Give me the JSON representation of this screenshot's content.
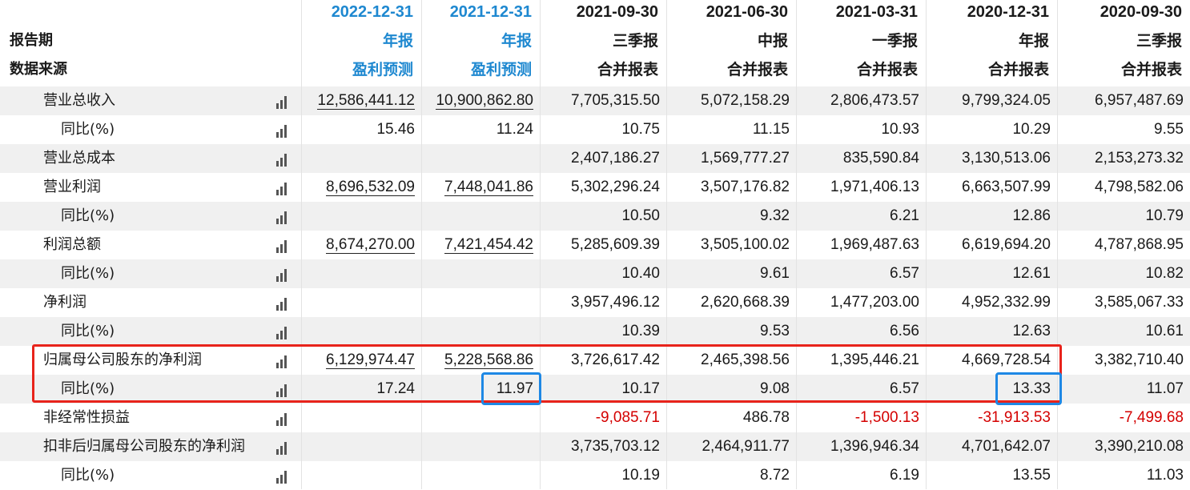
{
  "header": {
    "row_labels": [
      "报告期",
      "数据来源"
    ],
    "columns": [
      {
        "date": "2022-12-31",
        "period": "年报",
        "source": "盈利预测",
        "forecast": true
      },
      {
        "date": "2021-12-31",
        "period": "年报",
        "source": "盈利预测",
        "forecast": true
      },
      {
        "date": "2021-09-30",
        "period": "三季报",
        "source": "合并报表",
        "forecast": false
      },
      {
        "date": "2021-06-30",
        "period": "中报",
        "source": "合并报表",
        "forecast": false
      },
      {
        "date": "2021-03-31",
        "period": "一季报",
        "source": "合并报表",
        "forecast": false
      },
      {
        "date": "2020-12-31",
        "period": "年报",
        "source": "合并报表",
        "forecast": false
      },
      {
        "date": "2020-09-30",
        "period": "三季报",
        "source": "合并报表",
        "forecast": false
      }
    ]
  },
  "rows": [
    {
      "label": "营业总收入",
      "indent": false,
      "values": [
        "12,586,441.12",
        "10,900,862.80",
        "7,705,315.50",
        "5,072,158.29",
        "2,806,473.57",
        "9,799,324.05",
        "6,957,487.69"
      ]
    },
    {
      "label": "同比(%)",
      "indent": true,
      "values": [
        "15.46",
        "11.24",
        "10.75",
        "11.15",
        "10.93",
        "10.29",
        "9.55"
      ]
    },
    {
      "label": "营业总成本",
      "indent": false,
      "values": [
        "",
        "",
        "2,407,186.27",
        "1,569,777.27",
        "835,590.84",
        "3,130,513.06",
        "2,153,273.32"
      ]
    },
    {
      "label": "营业利润",
      "indent": false,
      "values": [
        "8,696,532.09",
        "7,448,041.86",
        "5,302,296.24",
        "3,507,176.82",
        "1,971,406.13",
        "6,663,507.99",
        "4,798,582.06"
      ]
    },
    {
      "label": "同比(%)",
      "indent": true,
      "values": [
        "",
        "",
        "10.50",
        "9.32",
        "6.21",
        "12.86",
        "10.79"
      ]
    },
    {
      "label": "利润总额",
      "indent": false,
      "values": [
        "8,674,270.00",
        "7,421,454.42",
        "5,285,609.39",
        "3,505,100.02",
        "1,969,487.63",
        "6,619,694.20",
        "4,787,868.95"
      ]
    },
    {
      "label": "同比(%)",
      "indent": true,
      "values": [
        "",
        "",
        "10.40",
        "9.61",
        "6.57",
        "12.61",
        "10.82"
      ]
    },
    {
      "label": "净利润",
      "indent": false,
      "values": [
        "",
        "",
        "3,957,496.12",
        "2,620,668.39",
        "1,477,203.00",
        "4,952,332.99",
        "3,585,067.33"
      ]
    },
    {
      "label": "同比(%)",
      "indent": true,
      "values": [
        "",
        "",
        "10.39",
        "9.53",
        "6.56",
        "12.63",
        "10.61"
      ]
    },
    {
      "label": "归属母公司股东的净利润",
      "indent": false,
      "values": [
        "6,129,974.47",
        "5,228,568.86",
        "3,726,617.42",
        "2,465,398.56",
        "1,395,446.21",
        "4,669,728.54",
        "3,382,710.40"
      ]
    },
    {
      "label": "同比(%)",
      "indent": true,
      "values": [
        "17.24",
        "11.97",
        "10.17",
        "9.08",
        "6.57",
        "13.33",
        "11.07"
      ]
    },
    {
      "label": "非经常性损益",
      "indent": false,
      "values": [
        "",
        "",
        "-9,085.71",
        "486.78",
        "-1,500.13",
        "-31,913.53",
        "-7,499.68"
      ]
    },
    {
      "label": "扣非后归属母公司股东的净利润",
      "indent": false,
      "values": [
        "",
        "",
        "3,735,703.12",
        "2,464,911.77",
        "1,396,946.34",
        "4,701,642.07",
        "3,390,210.08"
      ]
    },
    {
      "label": "同比(%)",
      "indent": true,
      "values": [
        "",
        "",
        "10.19",
        "8.72",
        "6.19",
        "13.55",
        "11.03"
      ]
    }
  ],
  "colors": {
    "forecast_blue": "#1e88d0",
    "negative_red": "#d40000",
    "highlight_red_box": "#e8231b",
    "highlight_blue_box": "#1e88e5",
    "row_shade": "#f0f0f0"
  },
  "icons": {
    "row_chart": "bar-chart-icon"
  }
}
